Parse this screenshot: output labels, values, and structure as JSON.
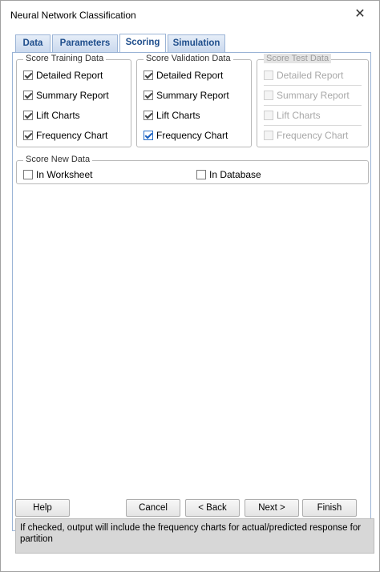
{
  "window": {
    "title": "Neural Network Classification"
  },
  "tabs": [
    {
      "label": "Data"
    },
    {
      "label": "Parameters"
    },
    {
      "label": "Scoring"
    },
    {
      "label": "Simulation"
    }
  ],
  "score_training": {
    "legend": "Score Training Data",
    "items": [
      {
        "label": "Detailed Report",
        "checked": true
      },
      {
        "label": "Summary Report",
        "checked": true
      },
      {
        "label": "Lift Charts",
        "checked": true
      },
      {
        "label": "Frequency Chart",
        "checked": true
      }
    ]
  },
  "score_validation": {
    "legend": "Score Validation Data",
    "items": [
      {
        "label": "Detailed Report",
        "checked": true
      },
      {
        "label": "Summary Report",
        "checked": true
      },
      {
        "label": "Lift Charts",
        "checked": true
      },
      {
        "label": "Frequency Chart",
        "checked": true
      }
    ]
  },
  "score_test": {
    "legend": "Score Test Data",
    "items": [
      {
        "label": "Detailed Report",
        "checked": false
      },
      {
        "label": "Summary Report",
        "checked": false
      },
      {
        "label": "Lift Charts",
        "checked": false
      },
      {
        "label": "Frequency Chart",
        "checked": false
      }
    ]
  },
  "score_new": {
    "legend": "Score New Data",
    "in_worksheet": "In Worksheet",
    "in_database": "In Database"
  },
  "buttons": {
    "help": "Help",
    "cancel": "Cancel",
    "back": "< Back",
    "next": "Next >",
    "finish": "Finish"
  },
  "status_text": "If checked, output will include the frequency charts for actual/predicted response for partition",
  "colors": {
    "tab_text": "#1f4e8c",
    "tab_border": "#9bb4d6",
    "status_bg": "#d7d7d7"
  }
}
